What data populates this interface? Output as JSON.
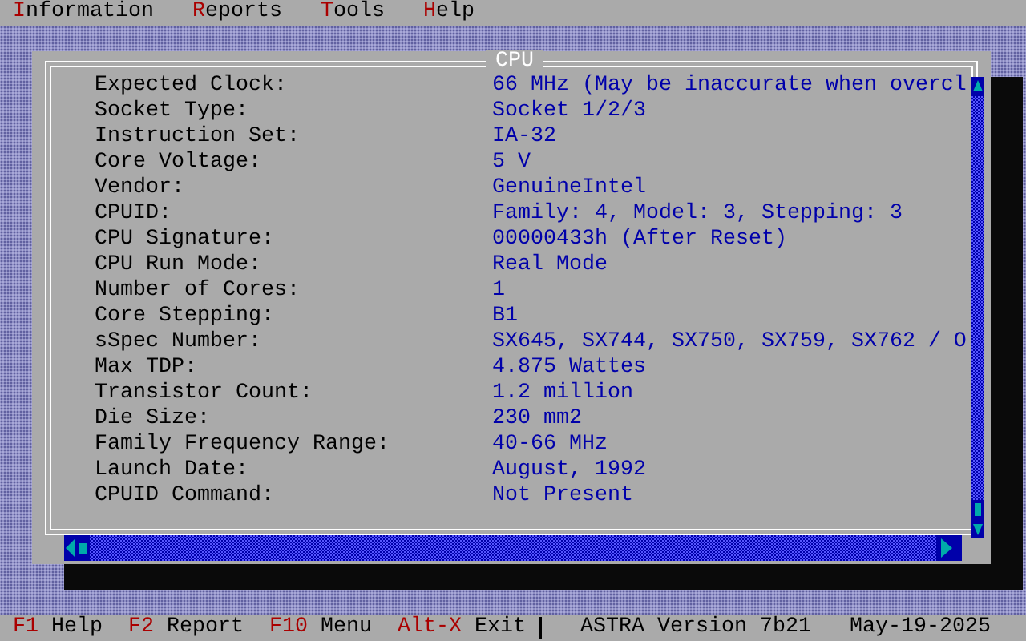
{
  "menu": [
    {
      "hotkey": "I",
      "rest": "nformation"
    },
    {
      "hotkey": "R",
      "rest": "eports"
    },
    {
      "hotkey": "T",
      "rest": "ools"
    },
    {
      "hotkey": "H",
      "rest": "elp"
    }
  ],
  "window": {
    "title": "CPU"
  },
  "rows": [
    {
      "label": "Expected Clock:",
      "value": "66 MHz (May be inaccurate when overcl"
    },
    {
      "label": "Socket Type:",
      "value": "Socket 1/2/3"
    },
    {
      "label": "Instruction Set:",
      "value": "IA-32"
    },
    {
      "label": "Core Voltage:",
      "value": "5 V"
    },
    {
      "label": "Vendor:",
      "value": "GenuineIntel"
    },
    {
      "label": "CPUID:",
      "value": "Family: 4, Model: 3, Stepping: 3"
    },
    {
      "label": "CPU Signature:",
      "value": "00000433h (After Reset)"
    },
    {
      "label": "CPU Run Mode:",
      "value": "Real Mode"
    },
    {
      "label": "Number of Cores:",
      "value": "1"
    },
    {
      "label": "Core Stepping:",
      "value": "B1"
    },
    {
      "label": "sSpec Number:",
      "value": "SX645, SX744, SX750, SX759, SX762 / O"
    },
    {
      "label": "Max TDP:",
      "value": "4.875 Wattes"
    },
    {
      "label": "Transistor Count:",
      "value": "1.2 million"
    },
    {
      "label": "Die Size:",
      "value": "230 mm2"
    },
    {
      "label": "Family Frequency Range:",
      "value": "40-66 MHz"
    },
    {
      "label": "Launch Date:",
      "value": "August, 1992"
    },
    {
      "label": "CPUID Command:",
      "value": "Not Present"
    }
  ],
  "status_bar": {
    "keys": [
      {
        "key": "F1",
        "label": "Help"
      },
      {
        "key": "F2",
        "label": "Report"
      },
      {
        "key": "F10",
        "label": "Menu"
      },
      {
        "key": "Alt-X",
        "label": "Exit"
      }
    ],
    "version": "ASTRA Version 7b21",
    "date": "May-19-2025"
  }
}
